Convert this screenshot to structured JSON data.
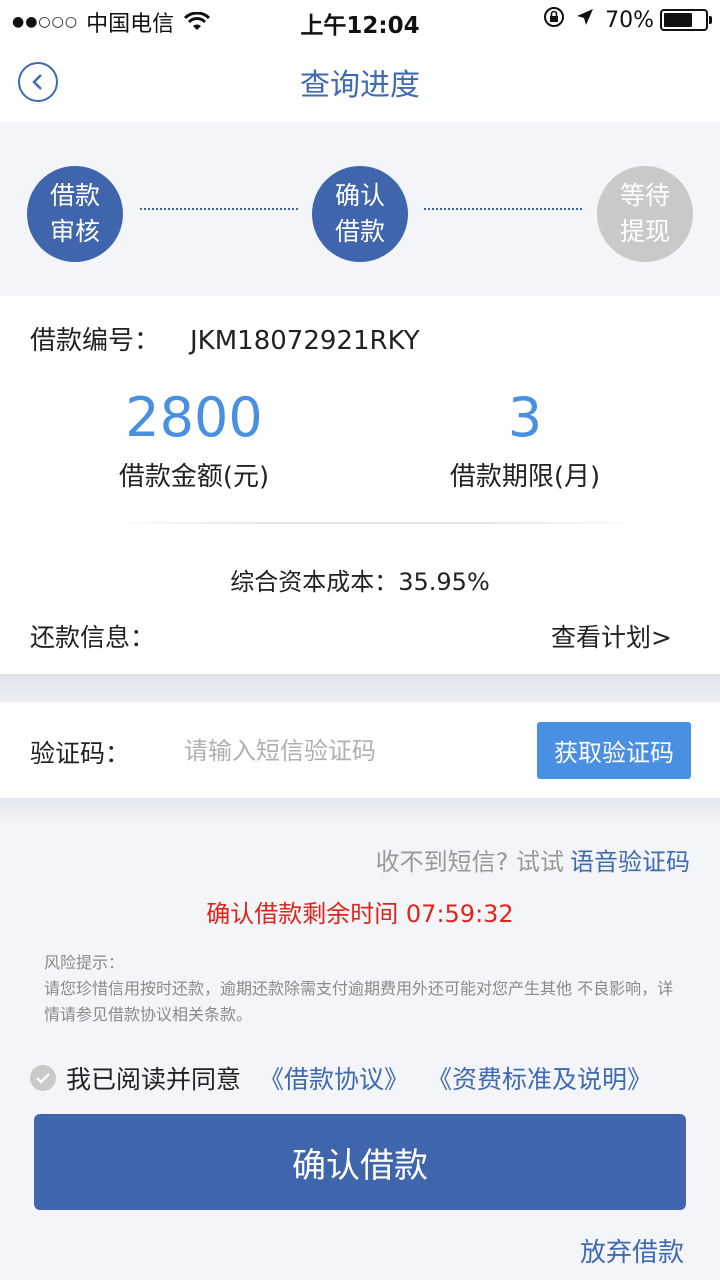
{
  "status_bar": {
    "signal": "●●○○○",
    "carrier": "中国电信",
    "time": "上午12:04",
    "battery": "70%",
    "battery_level": 0.7
  },
  "nav": {
    "title": "查询进度"
  },
  "steps": [
    {
      "line1": "借款",
      "line2": "审核",
      "state": "done"
    },
    {
      "line1": "确认",
      "line2": "借款",
      "state": "done"
    },
    {
      "line1": "等待",
      "line2": "提现",
      "state": "pending"
    }
  ],
  "loan": {
    "number_label": "借款编号：",
    "number": "JKM18072921RKY",
    "amount": "2800",
    "amount_label": "借款金额(元)",
    "term": "3",
    "term_label": "借款期限(月)",
    "cost": "综合资本成本：35.95%",
    "repay_label": "还款信息：",
    "repay_link": "查看计划>"
  },
  "verify": {
    "label": "验证码：",
    "placeholder": "请输入短信验证码",
    "button": "获取验证码",
    "no_sms": "收不到短信? 试试",
    "voice_link": "语音验证码"
  },
  "countdown": "确认借款剩余时间 07:59:32",
  "risk": {
    "title": "风险提示：",
    "text": "请您珍惜信用按时还款，逾期还款除需支付逾期费用外还可能对您产生其他 不良影响，详情请参见借款协议相关条款。"
  },
  "agreement": {
    "prefix": "我已阅读并同意",
    "doc1": "《借款协议》",
    "doc2": "《资费标准及说明》"
  },
  "buttons": {
    "confirm": "确认借款",
    "abandon": "放弃借款"
  },
  "colors": {
    "primary": "#3f65ad",
    "accent": "#4a90e2",
    "warning": "#e2231a",
    "inactive": "#c9c9c9"
  }
}
